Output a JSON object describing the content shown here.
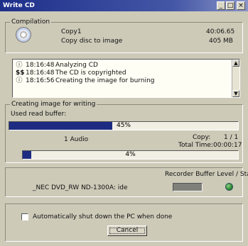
{
  "window": {
    "title": "Write CD",
    "controls": {
      "minimize": "_",
      "maximize": "□",
      "close": "×"
    }
  },
  "compilation": {
    "legend": "Compilation",
    "name": "Copy1",
    "action": "Copy disc to image",
    "time": "40:06.65",
    "size": "405 MB",
    "icon": "disc-icon"
  },
  "log": {
    "entries": [
      {
        "time": "18:16:48",
        "message": "Analyzing CD",
        "icon": "info-icon",
        "glyph": "ⓘ"
      },
      {
        "time": "18:16:48",
        "message": "The CD is copyrighted",
        "icon": "copyright-icon",
        "glyph": "$$"
      },
      {
        "time": "18:16:56",
        "message": "Creating the image for burning",
        "icon": "info-icon",
        "glyph": "ⓘ"
      }
    ],
    "scroll_up": "▲",
    "scroll_down": "▼"
  },
  "progress": {
    "legend": "Creating image for writing",
    "buffer_label": "Used read buffer:",
    "buffer_percent": 45,
    "buffer_text": "45%",
    "track_label": "1 Audio",
    "copy_label": "Copy:",
    "copy_value": "1 / 1",
    "total_time_label": "Total Time:",
    "total_time_value": "00:00:17",
    "overall_percent": 4,
    "overall_text": "4%"
  },
  "recorder": {
    "label": "Recorder Buffer Level / State",
    "device": "_NEC DVD_RW ND-1300A: ide",
    "state_color": "#2e8b3a"
  },
  "options": {
    "shutdown_label": "Automatically shut down the PC when done",
    "shutdown_checked": false
  },
  "buttons": {
    "cancel": "Cancel"
  }
}
